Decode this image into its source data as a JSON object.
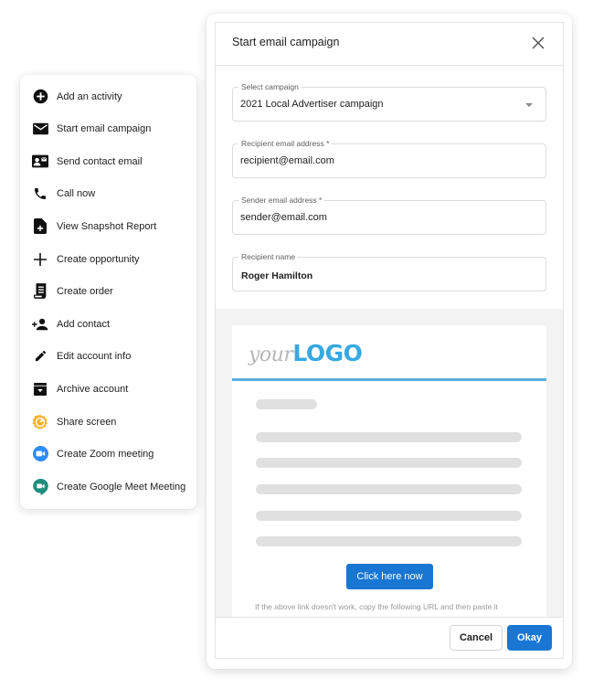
{
  "menu": {
    "items": [
      {
        "label": "Add an activity",
        "icon": "add-circle-icon"
      },
      {
        "label": "Start email campaign",
        "icon": "email-icon"
      },
      {
        "label": "Send contact email",
        "icon": "contact-mail-icon"
      },
      {
        "label": "Call now",
        "icon": "phone-icon"
      },
      {
        "label": "View Snapshot Report",
        "icon": "note-add-icon"
      },
      {
        "label": "Create opportunity",
        "icon": "plus-icon"
      },
      {
        "label": "Create order",
        "icon": "receipt-icon"
      },
      {
        "label": "Add contact",
        "icon": "person-add-icon"
      },
      {
        "label": "Edit account info",
        "icon": "pencil-icon"
      },
      {
        "label": "Archive account",
        "icon": "archive-icon"
      },
      {
        "label": "Share screen",
        "icon": "screenshare-icon"
      },
      {
        "label": "Create Zoom meeting",
        "icon": "zoom-icon"
      },
      {
        "label": "Create Google Meet Meeting",
        "icon": "google-meet-icon"
      }
    ]
  },
  "modal": {
    "title": "Start email campaign",
    "close_icon": "close-icon",
    "fields": {
      "campaign": {
        "label": "Select campaign",
        "value": "2021 Local Advertiser campaign"
      },
      "recipient_email": {
        "label": "Recipient email address *",
        "value": "recipient@email.com"
      },
      "sender_email": {
        "label": "Sender email address *",
        "value": "sender@email.com"
      },
      "recipient_name": {
        "label": "Recipient name",
        "value": "Roger Hamilton"
      }
    },
    "preview": {
      "logo_prefix": "your",
      "logo_brand": "LOGO",
      "cta_label": "Click here now",
      "fallback_text": "If the above link doesn't work, copy the following URL and then paste it"
    },
    "footer": {
      "cancel_label": "Cancel",
      "okay_label": "Okay"
    }
  },
  "colors": {
    "primary": "#1976d2",
    "logo_blue": "#36a9e1",
    "share_screen": "#f6b22e",
    "zoom": "#2d8cff",
    "google_meet": "#1e8e7e"
  }
}
